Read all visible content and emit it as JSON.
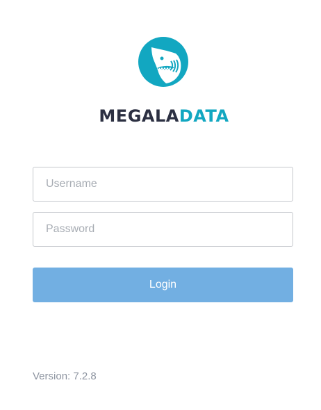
{
  "brand": {
    "name_part_1": "MEGALA",
    "name_part_2": "DATA",
    "logo_icon": "shark-logo-icon",
    "accent_color": "#12a7c1",
    "dark_color": "#2c3042"
  },
  "login_form": {
    "username_placeholder": "Username",
    "username_value": "",
    "password_placeholder": "Password",
    "password_value": "",
    "login_label": "Login",
    "login_button_color": "#72afe2"
  },
  "footer": {
    "version_text": "Version: 7.2.8"
  }
}
